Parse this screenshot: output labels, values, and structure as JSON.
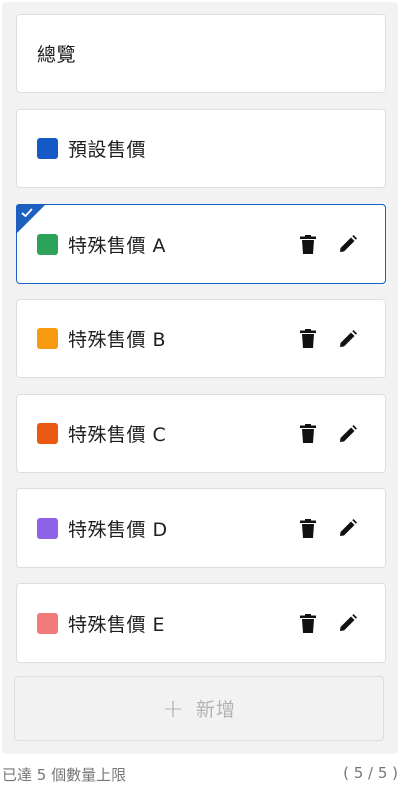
{
  "overview": {
    "label": "總覽"
  },
  "default_price": {
    "label": "預設售價",
    "color": "#1459c7"
  },
  "special_prices": [
    {
      "label": "特殊售價 A",
      "color": "#2da25a",
      "selected": true
    },
    {
      "label": "特殊售價 B",
      "color": "#f79a0f",
      "selected": false
    },
    {
      "label": "特殊售價 C",
      "color": "#e85a12",
      "selected": false
    },
    {
      "label": "特殊售價 D",
      "color": "#8f62ea",
      "selected": false
    },
    {
      "label": "特殊售價 E",
      "color": "#f17a7a",
      "selected": false
    }
  ],
  "actions": {
    "delete_icon": "trash-icon",
    "edit_icon": "pencil-icon"
  },
  "add_button": {
    "plus": "+",
    "label": "新增"
  },
  "footer": {
    "limit_text": "已達 5 個數量上限",
    "count_text": "( 5 / 5 )"
  },
  "accent_color": "#1c5fbf"
}
